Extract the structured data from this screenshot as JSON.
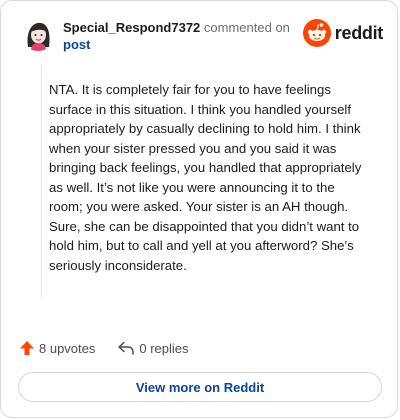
{
  "comment": {
    "username": "Special_Respond7372",
    "action_text": "commented on",
    "post_link": "post",
    "avatar_icon": "avatar-illustration",
    "body": "NTA. It is completely fair for you to have feelings surface in this situation. I think you handled yourself appropriately by casually declining to hold him. I think when your sister pressed you and you said it was bringing back feelings, you handled that appropriately as well. It’s not like you were announcing it to the room; you were asked. Your sister is an AH though. Sure, she can be disappointed that you didn’t want to hold him, but to call and yell at you afterword? She’s seriously inconsiderate."
  },
  "brand": {
    "name": "reddit",
    "color": "#ff4500",
    "icon": "reddit-snoo-icon"
  },
  "actions": {
    "upvotes": "8 upvotes",
    "upvote_icon": "upvote-arrow-icon",
    "upvote_color": "#ff4500",
    "replies": "0 replies",
    "reply_icon": "reply-arrow-icon"
  },
  "footer": {
    "view_more": "View more on Reddit",
    "link_color": "#0a449b"
  }
}
